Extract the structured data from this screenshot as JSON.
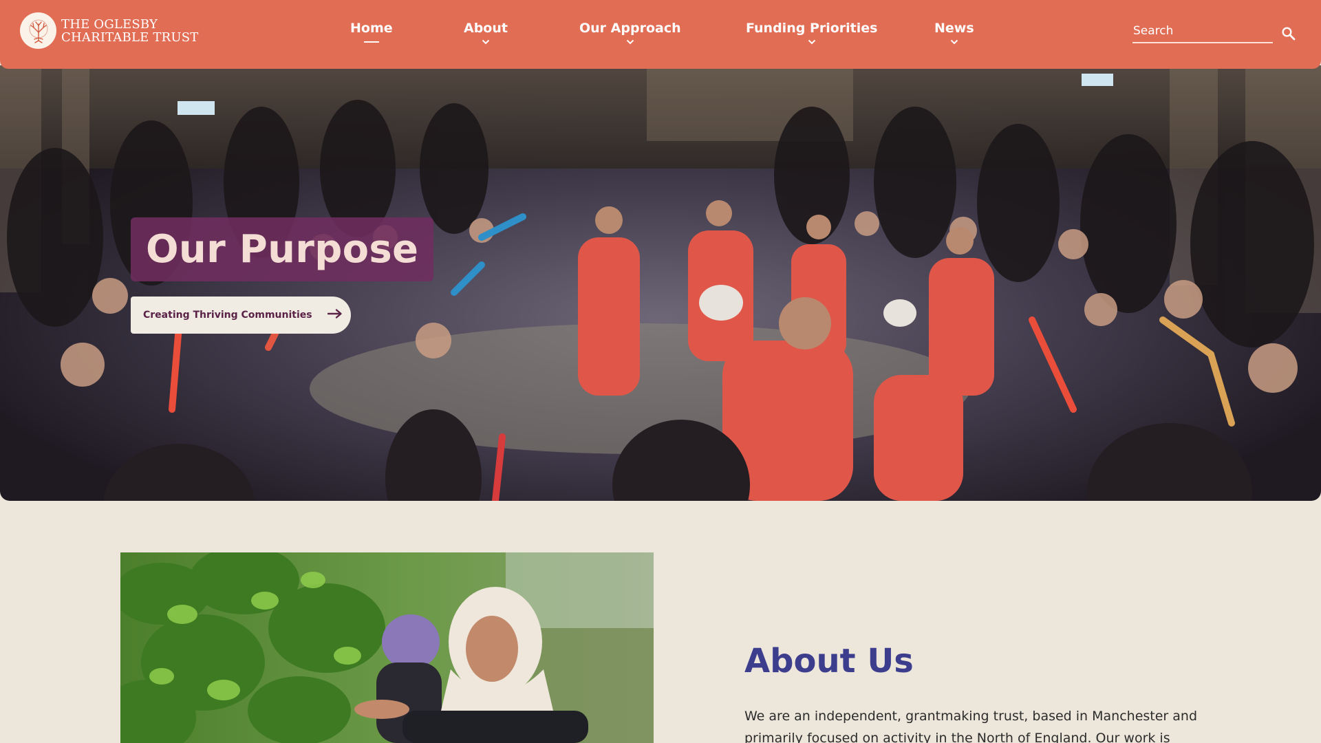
{
  "header": {
    "logo_line1": "THE OGLESBY",
    "logo_line2": "CHARITABLE TRUST",
    "nav": [
      {
        "label": "Home",
        "active": true
      },
      {
        "label": "About",
        "has_dropdown": true
      },
      {
        "label": "Our Approach",
        "has_dropdown": true
      },
      {
        "label": "Funding Priorities",
        "has_dropdown": true
      },
      {
        "label": "News",
        "has_dropdown": true
      }
    ],
    "search_placeholder": "Search"
  },
  "hero": {
    "title": "Our Purpose",
    "cta_label": "Creating Thriving Communities"
  },
  "about": {
    "title": "About Us",
    "text": "We are an independent, grantmaking trust, based in Manchester and primarily focused on activity in the North of England. Our work is driven"
  },
  "icons": {
    "logo": "tree-icon",
    "nav_chevron": "chevron-down-icon",
    "search": "search-icon",
    "cta_arrow": "arrow-right-icon"
  },
  "colors": {
    "header_bg": "#e26d55",
    "page_bg": "#ede6da",
    "hero_title_bg": "#702e5e",
    "about_title": "#3d3d8e"
  }
}
